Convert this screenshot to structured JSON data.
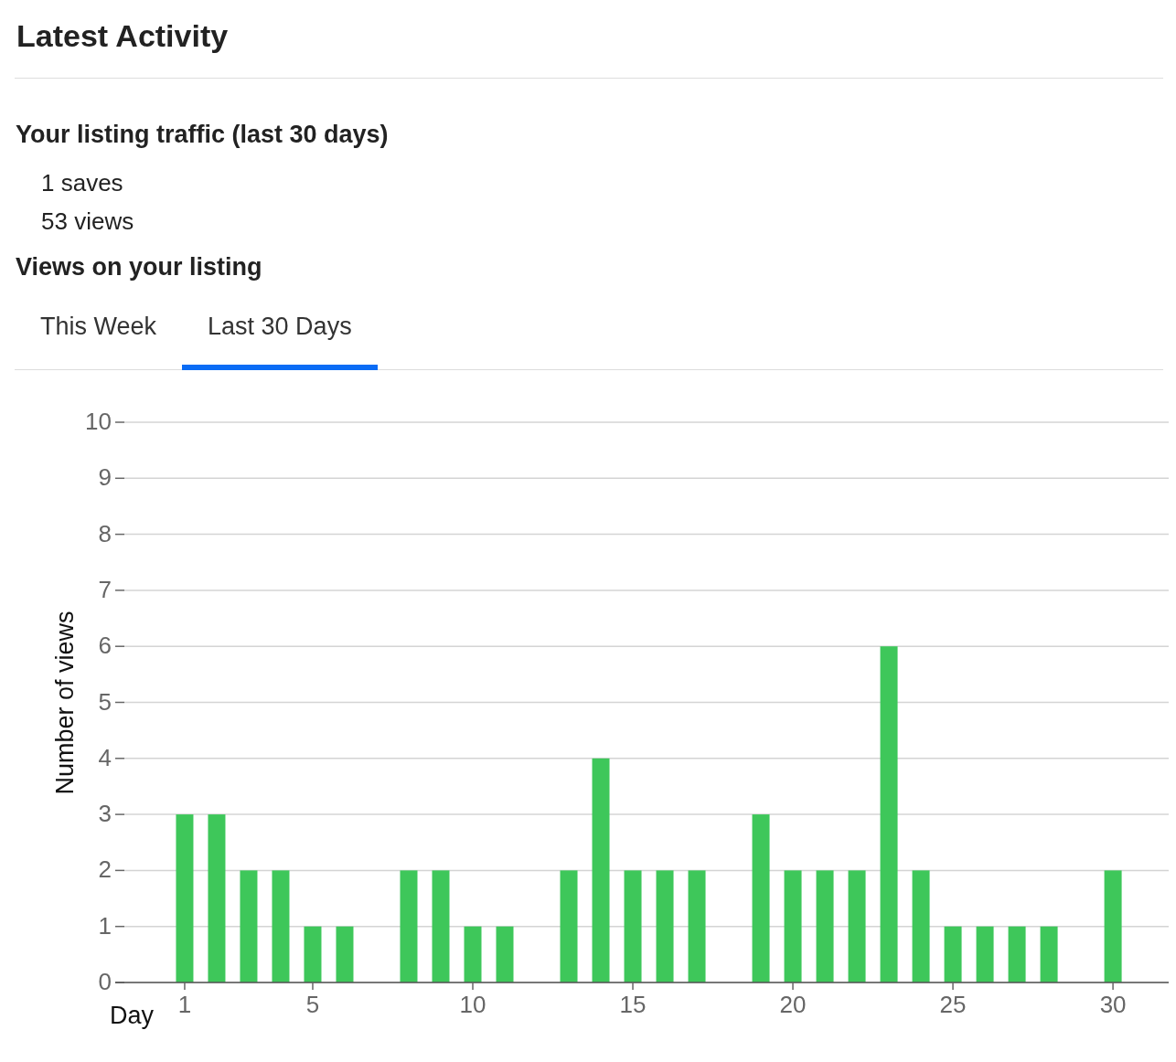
{
  "header": {
    "title": "Latest Activity"
  },
  "traffic": {
    "title": "Your listing traffic (last 30 days)",
    "stats": [
      "1 saves",
      "53 views"
    ]
  },
  "views": {
    "title": "Views on your listing",
    "tabs": [
      {
        "label": "This Week",
        "selected": false
      },
      {
        "label": "Last 30 Days",
        "selected": true
      }
    ],
    "chart_data": {
      "type": "bar",
      "xlabel": "Day",
      "ylabel": "Number of views",
      "x": [
        1,
        2,
        3,
        4,
        5,
        6,
        7,
        8,
        9,
        10,
        11,
        12,
        13,
        14,
        15,
        16,
        17,
        18,
        19,
        20,
        21,
        22,
        23,
        24,
        25,
        26,
        27,
        28,
        29,
        30
      ],
      "grid": true,
      "xlim": [
        -1.17,
        31.74
      ],
      "series": [
        {
          "color": "#3ec75a",
          "values": [
            3,
            3,
            2,
            2,
            1,
            1,
            0,
            2,
            2,
            1,
            1,
            0,
            2,
            4,
            2,
            2,
            2,
            0,
            3,
            2,
            2,
            2,
            6,
            2,
            1,
            1,
            1,
            1,
            0,
            2
          ]
        }
      ],
      "ylim": [
        0,
        10
      ],
      "yticks": [
        0,
        1,
        2,
        3,
        4,
        5,
        6,
        7,
        8,
        9,
        10
      ],
      "xticks": [
        1,
        5,
        10,
        15,
        20,
        25,
        30
      ]
    }
  }
}
